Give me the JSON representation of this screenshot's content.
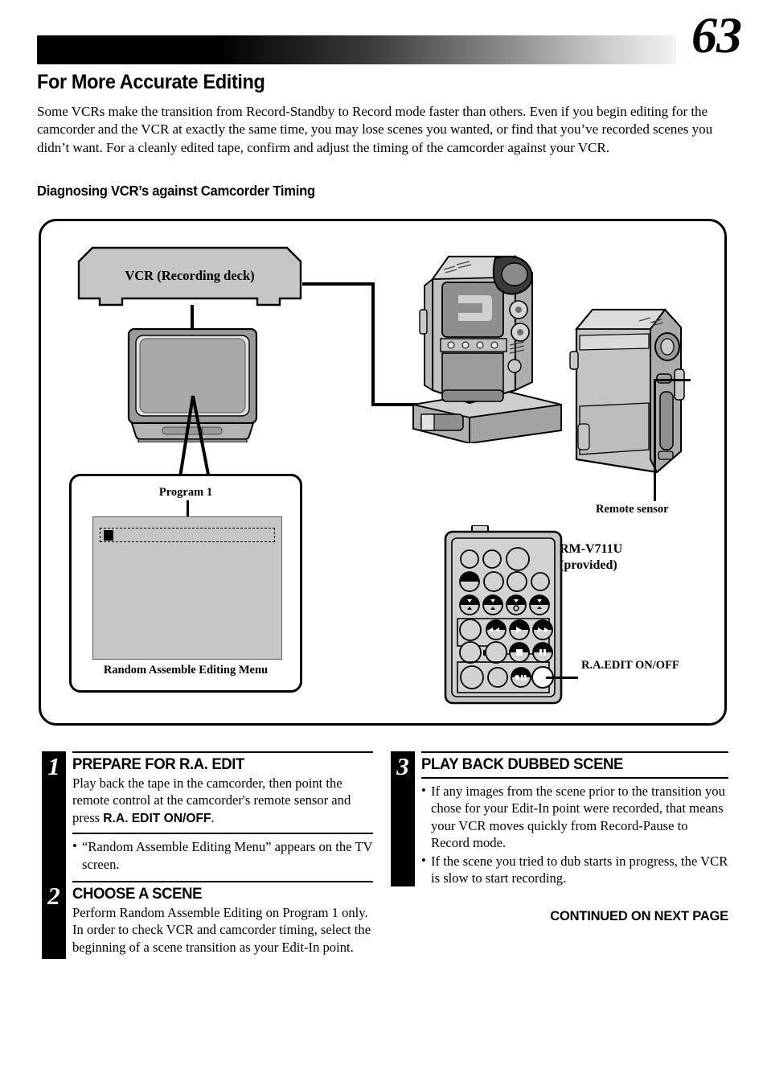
{
  "header": {
    "page_number": "63",
    "title": "For More Accurate Editing",
    "intro": "Some VCRs make the transition from Record-Standby to Record mode faster than others. Even if you begin editing for the camcorder and the VCR at exactly the same time, you may lose scenes you wanted, or find that you’ve recorded scenes you didn’t want. For a cleanly edited tape, confirm and adjust the timing of the camcorder against your VCR.",
    "subtitle": "Diagnosing VCR’s against Camcorder Timing"
  },
  "diagram": {
    "vcr_label": "VCR (Recording deck)",
    "program_label": "Program 1",
    "menu_caption": "Random Assemble Editing Menu",
    "remote_sensor_label": "Remote sensor",
    "remote_model_label": "RM-V711U\n(provided)",
    "remote_model_line1": "RM-V711U",
    "remote_model_line2": "(provided)",
    "ra_edit_label": "R.A.EDIT ON/OFF"
  },
  "steps": [
    {
      "number": "1",
      "heading": "PREPARE FOR R.A. EDIT",
      "body_prefix": "Play back the tape in the camcorder, then point the remote control at the camcorder's remote sensor and press ",
      "body_bold": "R.A. EDIT ON/OFF",
      "body_suffix": ".",
      "bullets": [
        "“Random Assemble Editing Menu” appears on the TV screen."
      ]
    },
    {
      "number": "2",
      "heading": "CHOOSE A SCENE",
      "body": "Perform Random Assemble Editing on Program 1 only. In order to check VCR and camcorder timing, select the beginning of a scene transition as your Edit-In point.",
      "bullets": []
    },
    {
      "number": "3",
      "heading": "PLAY BACK DUBBED SCENE",
      "body": "",
      "bullets": [
        "If any images from the scene prior to the transition you chose for your Edit-In point were recorded, that means your VCR moves quickly from Record-Pause to Record mode.",
        "If the scene you tried to dub starts in progress, the VCR is slow to start recording."
      ]
    }
  ],
  "footer": {
    "continued": "CONTINUED ON NEXT PAGE"
  },
  "colors": {
    "ink": "#000000",
    "device_body": "#c6c6c6",
    "device_shade": "#9a9a9a",
    "device_dark": "#6e6e6e",
    "device_light": "#e2e2e2"
  }
}
